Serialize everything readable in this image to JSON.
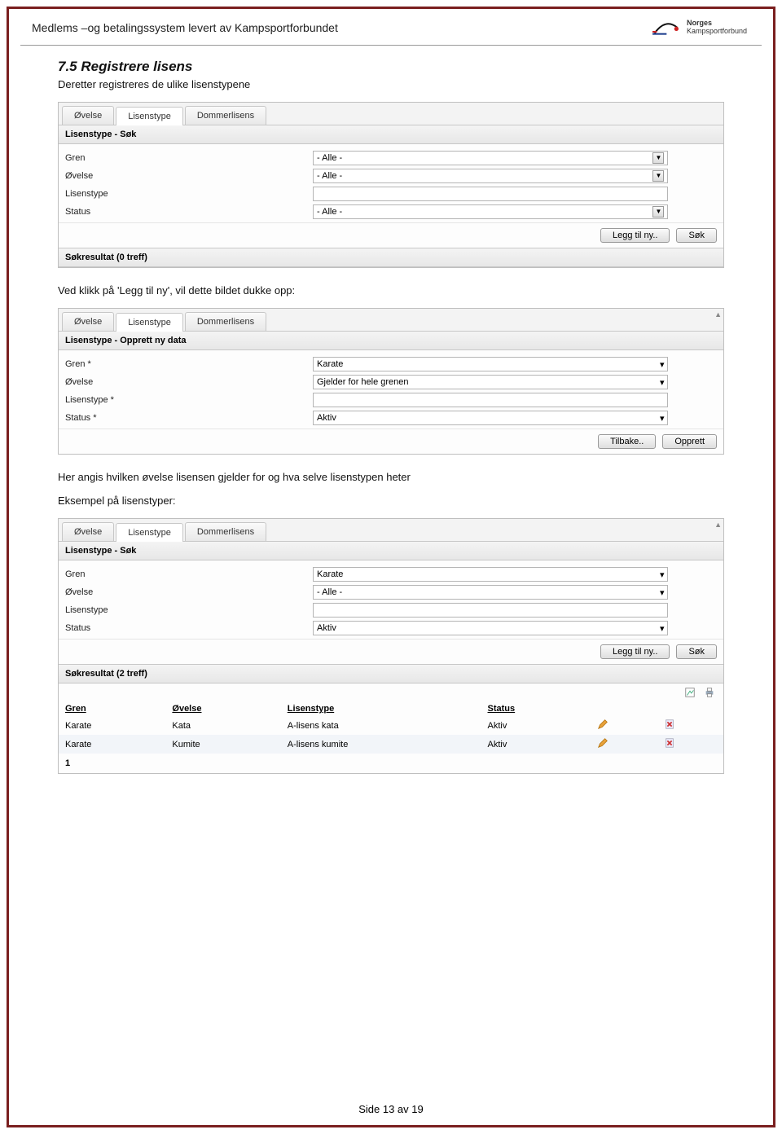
{
  "header": {
    "title": "Medlems –og betalingssystem levert av Kampsportforbundet",
    "logo_line1": "Norges",
    "logo_line2": "Kampsportforbund"
  },
  "section": {
    "number_title": "7.5  Registrere lisens",
    "intro": "Deretter registreres de ulike lisenstypene",
    "after_panel1": "Ved klikk på 'Legg til ny', vil dette bildet dukke opp:",
    "after_panel2": "Her angis hvilken øvelse lisensen gjelder for og hva selve lisenstypen heter",
    "example_label": "Eksempel på lisenstyper:"
  },
  "tabs": {
    "t1": "Øvelse",
    "t2": "Lisenstype",
    "t3": "Dommerlisens"
  },
  "panel1": {
    "title": "Lisenstype - Søk",
    "rows": {
      "gren": "Gren",
      "ovelse": "Øvelse",
      "lisenstype": "Lisenstype",
      "status": "Status"
    },
    "values": {
      "gren": "- Alle -",
      "ovelse": "- Alle -",
      "lisenstype": "",
      "status": "- Alle -"
    },
    "buttons": {
      "add": "Legg til ny..",
      "search": "Søk"
    },
    "resultbar": "Søkresultat (0 treff)"
  },
  "panel2": {
    "title": "Lisenstype - Opprett ny data",
    "rows": {
      "gren": "Gren *",
      "ovelse": "Øvelse",
      "lisenstype": "Lisenstype *",
      "status": "Status *"
    },
    "values": {
      "gren": "Karate",
      "ovelse": "Gjelder for hele grenen",
      "lisenstype": "",
      "status": "Aktiv"
    },
    "buttons": {
      "back": "Tilbake..",
      "create": "Opprett"
    }
  },
  "panel3": {
    "title": "Lisenstype - Søk",
    "rows": {
      "gren": "Gren",
      "ovelse": "Øvelse",
      "lisenstype": "Lisenstype",
      "status": "Status"
    },
    "values": {
      "gren": "Karate",
      "ovelse": "- Alle -",
      "lisenstype": "",
      "status": "Aktiv"
    },
    "buttons": {
      "add": "Legg til ny..",
      "search": "Søk"
    },
    "resultbar": "Søkresultat (2 treff)",
    "columns": {
      "gren": "Gren",
      "ovelse": "Øvelse",
      "lisenstype": "Lisenstype",
      "status": "Status"
    },
    "rows_data": [
      {
        "gren": "Karate",
        "ovelse": "Kata",
        "lisenstype": "A-lisens kata",
        "status": "Aktiv"
      },
      {
        "gren": "Karate",
        "ovelse": "Kumite",
        "lisenstype": "A-lisens kumite",
        "status": "Aktiv"
      }
    ],
    "pager": "1"
  },
  "footer": "Side 13 av 19"
}
